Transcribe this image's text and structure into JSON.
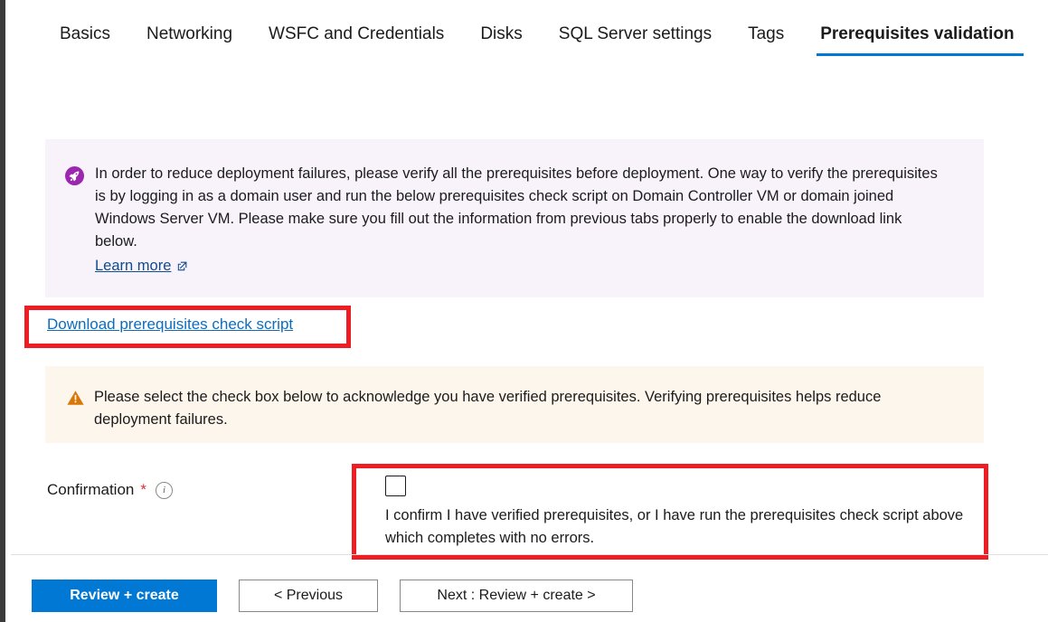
{
  "tabs": [
    {
      "label": "Basics",
      "selected": false
    },
    {
      "label": "Networking",
      "selected": false
    },
    {
      "label": "WSFC and Credentials",
      "selected": false
    },
    {
      "label": "Disks",
      "selected": false
    },
    {
      "label": "SQL Server settings",
      "selected": false
    },
    {
      "label": "Tags",
      "selected": false
    },
    {
      "label": "Prerequisites validation",
      "selected": true
    }
  ],
  "info_banner": {
    "icon": "rocket-icon",
    "text": "In order to reduce deployment failures, please verify all the prerequisites before deployment. One way to verify the prerequisites is by logging in as a domain user and run the below prerequisites check script on Domain Controller VM or domain joined Windows Server VM. Please make sure you fill out the information from previous tabs properly to enable the download link below.",
    "learn_more": "Learn more",
    "background": "#f8f3fb",
    "icon_color": "#9b27b0"
  },
  "download": {
    "link_label": "Download prerequisites check script",
    "link_color": "#0f6cbd",
    "highlight_color": "#ee1c23"
  },
  "warning_banner": {
    "icon": "warning-triangle-icon",
    "text": "Please select the check box below to acknowledge you have verified prerequisites. Verifying prerequisites helps reduce deployment failures.",
    "background": "#fdf6ec",
    "icon_color": "#d97706"
  },
  "confirmation": {
    "label": "Confirmation",
    "required_marker": "*",
    "info_icon": "info-circle-icon",
    "info_glyph": "i",
    "checkbox_checked": false,
    "checkbox_text": "I confirm I have verified prerequisites, or I have run the prerequisites check script above which completes with no errors.",
    "highlight_color": "#ee1c23"
  },
  "footer": {
    "primary_button": "Review + create",
    "previous_button": "< Previous",
    "next_button": "Next : Review + create >",
    "primary_color": "#0078d4"
  }
}
